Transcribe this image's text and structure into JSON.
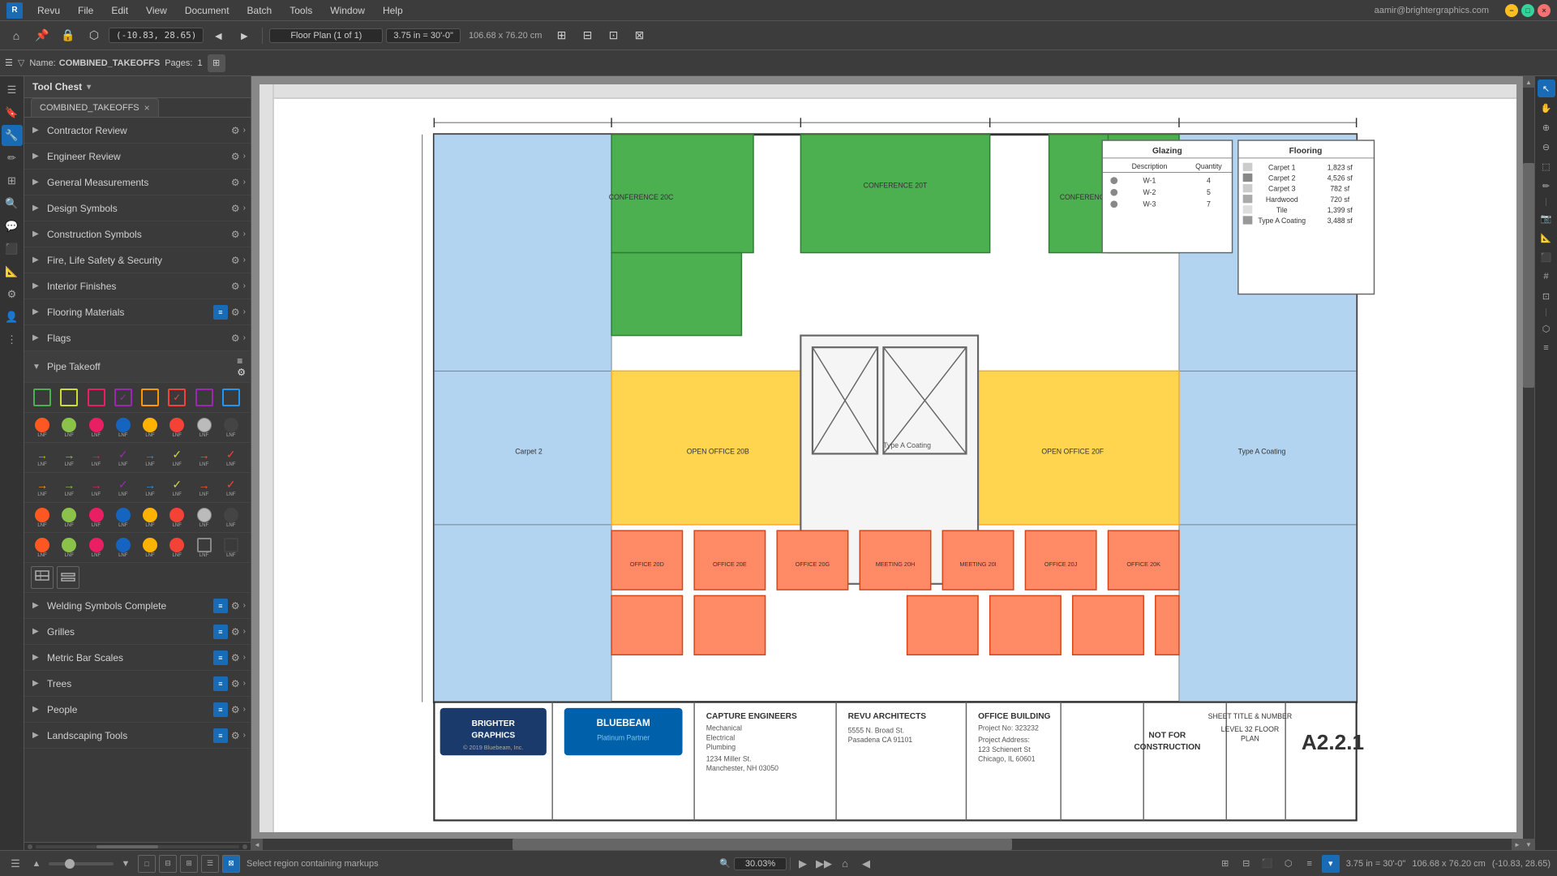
{
  "app": {
    "title": "Bluebeam Revu",
    "user_email": "aamir@brightergraphics.com"
  },
  "menu": {
    "items": [
      "Revu",
      "File",
      "Edit",
      "View",
      "Document",
      "Batch",
      "Tools",
      "Window",
      "Help"
    ]
  },
  "toolbar": {
    "coords": "(-10.83, 28.65)",
    "page_select": "Floor Plan (1 of 1)",
    "scale": "3.75 in = 30'-0\"",
    "dimensions": "106.68 x 76.20 cm",
    "nav_arrows": [
      "◄",
      "►"
    ]
  },
  "toolbar2": {
    "name_label": "Name:",
    "name_value": "COMBINED_TAKEOFFS",
    "pages_label": "Pages:",
    "pages_value": "1"
  },
  "canvas_tab": {
    "label": "COMBINED_TAKEOFFS",
    "close": "×"
  },
  "tool_chest": {
    "title": "Tool Chest",
    "items": [
      {
        "id": "contractor-review",
        "label": "Contractor Review",
        "has_gear": true,
        "has_arrow": true
      },
      {
        "id": "engineer-review",
        "label": "Engineer Review",
        "has_gear": true,
        "has_arrow": true
      },
      {
        "id": "general-measurements",
        "label": "General Measurements",
        "has_gear": true,
        "has_arrow": true
      },
      {
        "id": "design-symbols",
        "label": "Design Symbols",
        "has_gear": true,
        "has_arrow": true
      },
      {
        "id": "construction-symbols",
        "label": "Construction Symbols",
        "has_gear": true,
        "has_arrow": true
      },
      {
        "id": "fire-life-safety",
        "label": "Fire, Life Safety & Security",
        "has_gear": true,
        "has_arrow": true
      },
      {
        "id": "interior-finishes",
        "label": "Interior Finishes",
        "has_gear": true,
        "has_arrow": true
      },
      {
        "id": "flooring-materials",
        "label": "Flooring Materials",
        "has_gear": true,
        "has_blue": true,
        "has_arrow": true
      },
      {
        "id": "flags",
        "label": "Flags",
        "has_gear": true,
        "has_arrow": true
      }
    ],
    "pipe_takeoff": {
      "label": "Pipe Takeoff",
      "has_gear": true,
      "has_blue": true
    },
    "bottom_items": [
      {
        "id": "welding-symbols",
        "label": "Welding Symbols Complete",
        "has_gear": true,
        "has_blue": true,
        "has_arrow": true
      },
      {
        "id": "grilles",
        "label": "Grilles",
        "has_gear": true,
        "has_blue": true,
        "has_arrow": true
      },
      {
        "id": "metric-bar-scales",
        "label": "Metric Bar Scales",
        "has_gear": true,
        "has_blue": true,
        "has_arrow": true
      },
      {
        "id": "trees",
        "label": "Trees",
        "has_gear": true,
        "has_blue": true,
        "has_arrow": true
      },
      {
        "id": "people",
        "label": "People",
        "has_gear": true,
        "has_blue": true,
        "has_arrow": true
      },
      {
        "id": "landscaping-tools",
        "label": "Landscaping Tools",
        "has_gear": true,
        "has_blue": true,
        "has_arrow": true
      }
    ]
  },
  "glazing_table": {
    "title": "Glazing",
    "headers": [
      "Description",
      "Quantity"
    ],
    "rows": [
      {
        "color": "#888",
        "label": "W-1",
        "qty": "4"
      },
      {
        "color": "#888",
        "label": "W-2",
        "qty": "5"
      },
      {
        "color": "#888",
        "label": "W-3",
        "qty": "7"
      }
    ]
  },
  "flooring_table": {
    "title": "Flooring",
    "rows": [
      {
        "color": "#ccc",
        "label": "Carpet 1",
        "value": "1,823",
        "unit": "sf"
      },
      {
        "color": "#888",
        "label": "Carpet 2",
        "value": "4,526",
        "unit": "sf"
      },
      {
        "color": "#ccc",
        "label": "Carpet 3",
        "value": "782",
        "unit": "sf"
      },
      {
        "color": "#aaa",
        "label": "Hardwood",
        "value": "720",
        "unit": "sf"
      },
      {
        "color": "#ccc",
        "label": "Tile",
        "value": "1,399",
        "unit": "sf"
      },
      {
        "color": "#999",
        "label": "Type A Coating",
        "value": "3,488",
        "unit": "sf"
      }
    ]
  },
  "title_block": {
    "company1": "BRIGHTER\nGRAPHICS",
    "company2": "BLUEBEAM\nPlatinum Partner",
    "engineers": {
      "title": "CAPTURE ENGINEERS",
      "types": "Mechanical\nElectrical\nPlumbing",
      "address": "1234 Miller St.\nManchester, NH 03050"
    },
    "architects": {
      "title": "REVU ARCHITECTS",
      "address": "5555 N. Broad St.\nPasadena CA 91101"
    },
    "project": {
      "title": "OFFICE BUILDING",
      "number": "Project No: 323232",
      "address": "Project Address:\n123 Schienert St\nChicago, IL 60601"
    },
    "stamp1_text": "NOT FOR\nCONSTRUCTION",
    "sheet_title": "LEVEL 32 FLOOR\nPLAN",
    "sheet_number": "A2.2.1"
  },
  "zoom": {
    "level": "30.03%",
    "icon": "🔍"
  },
  "status_bar": {
    "left_text": "Select region containing markups",
    "scale": "3.75 in = 30'-0\"",
    "dims": "106.68 x 76.20 cm",
    "coords": "(-10.83, 28.65)"
  },
  "swatches": {
    "row1": [
      {
        "shape": "outline",
        "color": "#4caf50",
        "bg": "transparent"
      },
      {
        "shape": "outline",
        "color": "#cddc39",
        "bg": "transparent"
      },
      {
        "shape": "outline",
        "color": "#e91e63",
        "bg": "transparent"
      },
      {
        "shape": "outline-check",
        "color": "#9c27b0",
        "bg": "transparent"
      },
      {
        "shape": "outline",
        "color": "#ff9800",
        "bg": "transparent"
      },
      {
        "shape": "outline-check",
        "color": "#f44336",
        "bg": "transparent"
      },
      {
        "shape": "outline",
        "color": "#9c27b0",
        "bg": "transparent"
      },
      {
        "shape": "outline",
        "color": "#2196f3",
        "bg": "transparent"
      }
    ],
    "row2": [
      {
        "shape": "circle",
        "color": "#ff5722"
      },
      {
        "shape": "circle",
        "color": "#8bc34a"
      },
      {
        "shape": "circle",
        "color": "#e91e63"
      },
      {
        "shape": "circle",
        "color": "#1565c0"
      },
      {
        "shape": "circle",
        "color": "#ffb300"
      },
      {
        "shape": "circle",
        "color": "#f44336"
      },
      {
        "shape": "circle",
        "color": "#fff"
      },
      {
        "shape": "circle",
        "color": "#333"
      }
    ],
    "row3": [
      {
        "shape": "arrow",
        "color": "#ff9800"
      },
      {
        "shape": "arrow",
        "color": "#8bc34a"
      },
      {
        "shape": "arrow",
        "color": "#e91e63"
      },
      {
        "shape": "check",
        "color": "#9c27b0"
      },
      {
        "shape": "arrow",
        "color": "#2196f3"
      },
      {
        "shape": "check",
        "color": "#cddc39"
      },
      {
        "shape": "arrow",
        "color": "#ff5722"
      },
      {
        "shape": "check",
        "color": "#f44336"
      }
    ],
    "row4": [
      {
        "shape": "arrow",
        "color": "#ff9800"
      },
      {
        "shape": "arrow",
        "color": "#8bc34a"
      },
      {
        "shape": "arrow",
        "color": "#e91e63"
      },
      {
        "shape": "check",
        "color": "#9c27b0"
      },
      {
        "shape": "arrow",
        "color": "#2196f3"
      },
      {
        "shape": "check",
        "color": "#cddc39"
      },
      {
        "shape": "arrow",
        "color": "#ff5722"
      },
      {
        "shape": "check",
        "color": "#f44336"
      }
    ],
    "row5": [
      {
        "shape": "circle",
        "color": "#ff5722"
      },
      {
        "shape": "circle",
        "color": "#8bc34a"
      },
      {
        "shape": "circle",
        "color": "#e91e63"
      },
      {
        "shape": "circle",
        "color": "#1565c0"
      },
      {
        "shape": "circle",
        "color": "#ffb300"
      },
      {
        "shape": "circle",
        "color": "#f44336"
      },
      {
        "shape": "circle",
        "color": "#fff"
      },
      {
        "shape": "circle",
        "color": "#333"
      }
    ],
    "row6": [
      {
        "shape": "circle",
        "color": "#ff5722"
      },
      {
        "shape": "circle",
        "color": "#8bc34a"
      },
      {
        "shape": "circle",
        "color": "#e91e63"
      },
      {
        "shape": "circle",
        "color": "#1565c0"
      },
      {
        "shape": "circle",
        "color": "#ffb300"
      },
      {
        "shape": "circle",
        "color": "#f44336"
      },
      {
        "shape": "circle",
        "color": "#fff"
      },
      {
        "shape": "circle",
        "color": "#333"
      }
    ]
  },
  "icons": {
    "expand": "▶",
    "collapse": "▼",
    "gear": "⚙",
    "chevron_right": "›",
    "close": "×",
    "search": "🔍",
    "zoom_in": "+",
    "zoom_out": "−",
    "nav_prev": "◄",
    "nav_next": "►",
    "home": "⌂",
    "play": "▶",
    "rewind": "◀◀",
    "forward": "▶▶"
  }
}
